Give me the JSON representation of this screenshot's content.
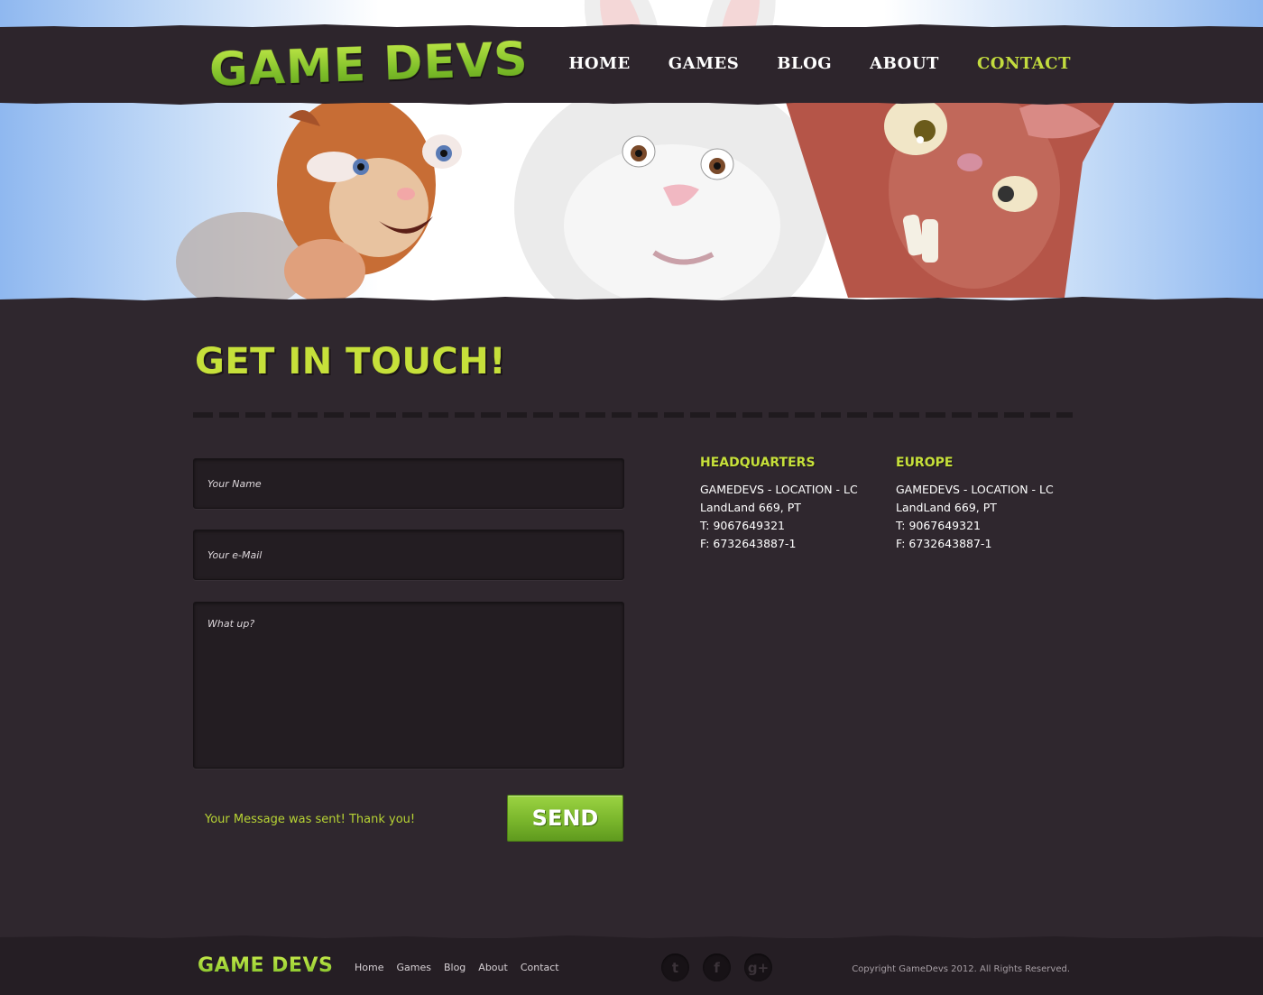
{
  "brand": {
    "logo_text": "GAME DEVS"
  },
  "nav": {
    "items": [
      "HOME",
      "GAMES",
      "BLOG",
      "ABOUT",
      "CONTACT"
    ],
    "active": "CONTACT"
  },
  "page": {
    "title": "GET IN TOUCH!"
  },
  "form": {
    "name_placeholder": "Your Name",
    "email_placeholder": "Your e-Mail",
    "message_placeholder": "What up?",
    "status_message": "Your Message was sent! Thank you!",
    "send_label": "SEND"
  },
  "offices": [
    {
      "heading": "HEADQUARTERS",
      "line1": "GAMEDEVS - LOCATION - LC",
      "line2": "LandLand 669, PT",
      "phone": "T: 9067649321",
      "fax": "F: 6732643887-1"
    },
    {
      "heading": "EUROPE",
      "line1": "GAMEDEVS - LOCATION - LC",
      "line2": "LandLand 669, PT",
      "phone": "T: 9067649321",
      "fax": "F: 6732643887-1"
    }
  ],
  "footer": {
    "logo_text": "GAME DEVS",
    "links": [
      "Home",
      "Games",
      "Blog",
      "About",
      "Contact"
    ],
    "social_icons": [
      "twitter-icon",
      "facebook-icon",
      "google-plus-icon"
    ],
    "social_glyphs": [
      "t",
      "f",
      "g+"
    ],
    "copyright": "Copyright GameDevs 2012. All Rights Reserved."
  },
  "colors": {
    "accent_green": "#c6e03a",
    "background": "#2f272e",
    "header_bar": "#2d252c",
    "button_green": "#7ab62c"
  }
}
